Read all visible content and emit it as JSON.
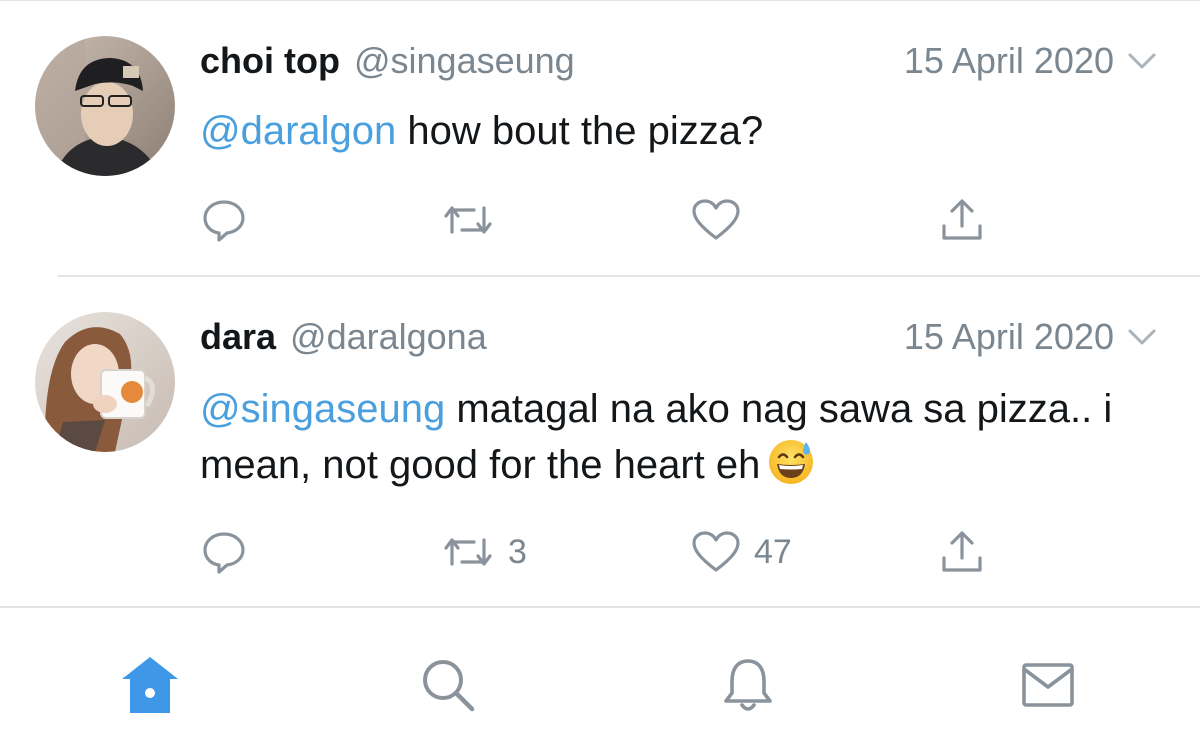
{
  "colors": {
    "mention": "#4a9fde",
    "secondary_text": "#7a8690",
    "active_tab": "#3f97e8",
    "inactive_icon": "#8a939b"
  },
  "tweets": [
    {
      "name": "choi top",
      "handle": "@singaseung",
      "date": "15 April 2020",
      "mention": "@daralgon",
      "text": " how bout the pizza?",
      "reply_count": "",
      "retweet_count": "",
      "like_count": ""
    },
    {
      "name": "dara",
      "handle": "@daralgona",
      "date": "15 April 2020",
      "mention": "@singaseung",
      "text": " matagal na ako nag sawa sa pizza.. i mean, not good for the heart eh",
      "emoji": "grinning-face-with-sweat",
      "reply_count": "",
      "retweet_count": "3",
      "like_count": "47"
    }
  ],
  "tabbar": {
    "items": [
      "home-icon",
      "search-icon",
      "notifications-icon",
      "messages-icon"
    ],
    "active": "home-icon"
  }
}
